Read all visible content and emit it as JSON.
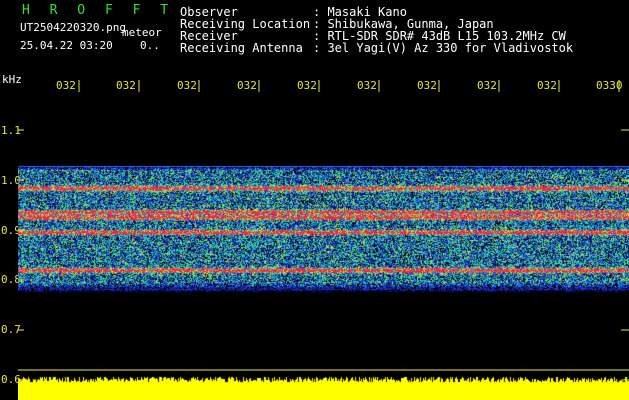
{
  "header": {
    "app_name": "H R O F F T",
    "filename": "UT2504220320.png",
    "meteor_label": "meteor",
    "datetime": "25.04.22 03:20",
    "count": "0..",
    "info": [
      {
        "label": "Observer",
        "value": ": Masaki Kano"
      },
      {
        "label": "Receiving Location",
        "value": ": Shibukawa, Gunma, Japan"
      },
      {
        "label": "Receiver",
        "value": ": RTL-SDR SDR# 43dB L15 103.2MHz CW"
      },
      {
        "label": "Receiving Antenna",
        "value": ": 3el Yagi(V) Az 330 for Vladivostok"
      }
    ]
  },
  "axis": {
    "unit": "kHz",
    "y_ticks": [
      "1.1",
      "1.0",
      "0.9",
      "0.8",
      "0.7",
      "0.6"
    ],
    "time_ticks": [
      "032",
      "032",
      "032",
      "032",
      "032",
      "032",
      "032",
      "032",
      "032",
      "0330"
    ]
  },
  "colors": {
    "background": "#000000",
    "text_white": "#ffffff",
    "text_yellow": "#e6e640",
    "title_green": "#33e033",
    "noise_band": "#1a1ad0",
    "signal_red": "#ff2040",
    "meteor_floor": "#ffff00"
  }
}
